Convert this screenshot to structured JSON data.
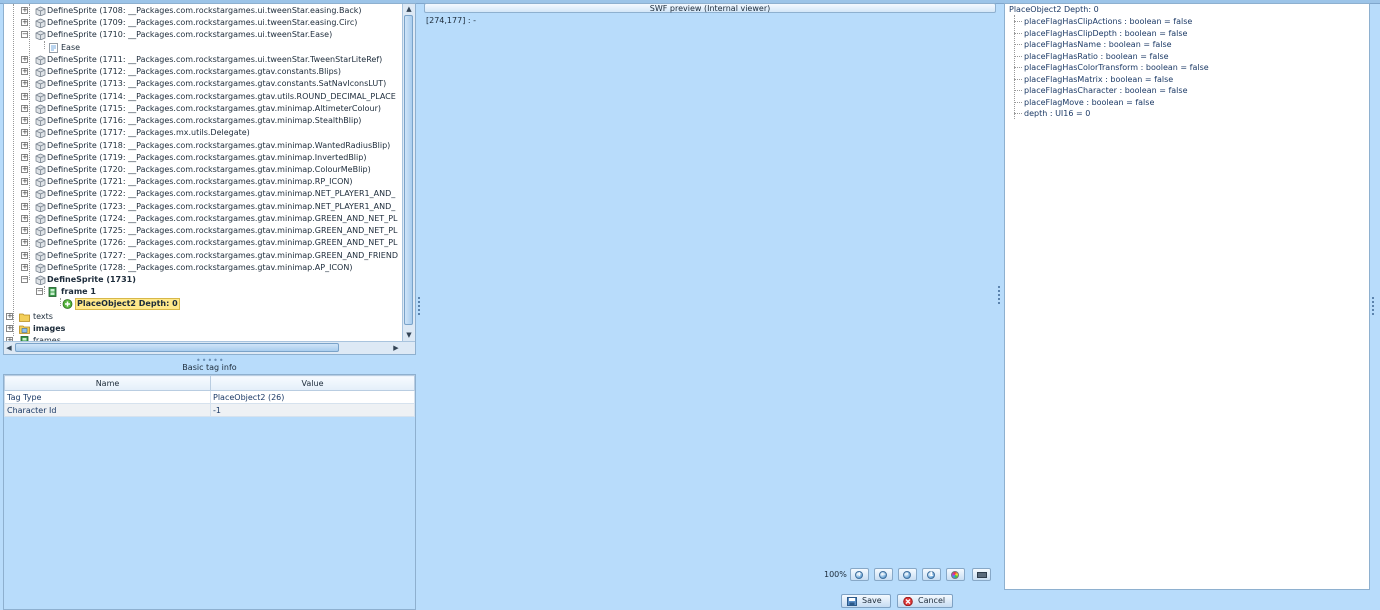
{
  "tree": {
    "items": [
      {
        "label": "DefineSprite (1708: __Packages.com.rockstargames.ui.tweenStar.easing.Back)"
      },
      {
        "label": "DefineSprite (1709: __Packages.com.rockstargames.ui.tweenStar.easing.Circ)"
      },
      {
        "label": "DefineSprite (1710: __Packages.com.rockstargames.ui.tweenStar.Ease)"
      },
      {
        "label": "Ease"
      },
      {
        "label": "DefineSprite (1711: __Packages.com.rockstargames.ui.tweenStar.TweenStarLiteRef)"
      },
      {
        "label": "DefineSprite (1712: __Packages.com.rockstargames.gtav.constants.Blips)"
      },
      {
        "label": "DefineSprite (1713: __Packages.com.rockstargames.gtav.constants.SatNavIconsLUT)"
      },
      {
        "label": "DefineSprite (1714: __Packages.com.rockstargames.gtav.utils.ROUND_DECIMAL_PLACE"
      },
      {
        "label": "DefineSprite (1715: __Packages.com.rockstargames.gtav.minimap.AltimeterColour)"
      },
      {
        "label": "DefineSprite (1716: __Packages.com.rockstargames.gtav.minimap.StealthBlip)"
      },
      {
        "label": "DefineSprite (1717: __Packages.mx.utils.Delegate)"
      },
      {
        "label": "DefineSprite (1718: __Packages.com.rockstargames.gtav.minimap.WantedRadiusBlip)"
      },
      {
        "label": "DefineSprite (1719: __Packages.com.rockstargames.gtav.minimap.InvertedBlip)"
      },
      {
        "label": "DefineSprite (1720: __Packages.com.rockstargames.gtav.minimap.ColourMeBlip)"
      },
      {
        "label": "DefineSprite (1721: __Packages.com.rockstargames.gtav.minimap.RP_ICON)"
      },
      {
        "label": "DefineSprite (1722: __Packages.com.rockstargames.gtav.minimap.NET_PLAYER1_AND_"
      },
      {
        "label": "DefineSprite (1723: __Packages.com.rockstargames.gtav.minimap.NET_PLAYER1_AND_"
      },
      {
        "label": "DefineSprite (1724: __Packages.com.rockstargames.gtav.minimap.GREEN_AND_NET_PL"
      },
      {
        "label": "DefineSprite (1725: __Packages.com.rockstargames.gtav.minimap.GREEN_AND_NET_PL"
      },
      {
        "label": "DefineSprite (1726: __Packages.com.rockstargames.gtav.minimap.GREEN_AND_NET_PL"
      },
      {
        "label": "DefineSprite (1727: __Packages.com.rockstargames.gtav.minimap.GREEN_AND_FRIEND"
      },
      {
        "label": "DefineSprite (1728: __Packages.com.rockstargames.gtav.minimap.AP_ICON)"
      },
      {
        "label": "DefineSprite (1731)"
      },
      {
        "label": "frame 1"
      },
      {
        "label": "PlaceObject2 Depth: 0"
      },
      {
        "label": "texts"
      },
      {
        "label": "images"
      },
      {
        "label": "frames"
      }
    ]
  },
  "basic_tag_info": {
    "title": "Basic tag info",
    "col_name": "Name",
    "col_value": "Value",
    "rows": [
      {
        "name": "Tag Type",
        "value": "PlaceObject2 (26)"
      },
      {
        "name": "Character Id",
        "value": "-1"
      }
    ]
  },
  "preview": {
    "title": "SWF preview (Internal viewer)",
    "coords": "[274,177] : -",
    "zoom": "100%",
    "save": "Save",
    "cancel": "Cancel"
  },
  "details": {
    "root": "PlaceObject2 Depth: 0",
    "props": [
      "placeFlagHasClipActions : boolean = false",
      "placeFlagHasClipDepth : boolean = false",
      "placeFlagHasName : boolean = false",
      "placeFlagHasRatio : boolean = false",
      "placeFlagHasColorTransform : boolean = false",
      "placeFlagHasMatrix : boolean = false",
      "placeFlagHasCharacter : boolean = false",
      "placeFlagMove : boolean = false",
      "depth : UI16 = 0"
    ]
  },
  "colors": {
    "background": "#b8dcfb",
    "selection": "#ffe88a",
    "link_text": "#1c3a66"
  }
}
